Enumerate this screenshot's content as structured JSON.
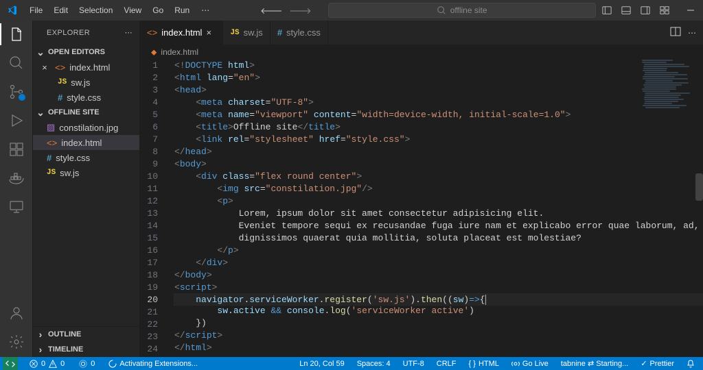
{
  "menu": [
    "File",
    "Edit",
    "Selection",
    "View",
    "Go",
    "Run"
  ],
  "search_placeholder": "offline site",
  "explorer": {
    "title": "EXPLORER",
    "open_editors_label": "OPEN EDITORS",
    "open_editors": [
      {
        "icon": "html",
        "name": "index.html",
        "closable": true
      },
      {
        "icon": "js",
        "name": "sw.js"
      },
      {
        "icon": "css",
        "name": "style.css"
      }
    ],
    "folder_label": "OFFLINE SITE",
    "files": [
      {
        "icon": "img",
        "name": "constilation.jpg"
      },
      {
        "icon": "html",
        "name": "index.html",
        "selected": true
      },
      {
        "icon": "css",
        "name": "style.css"
      },
      {
        "icon": "js",
        "name": "sw.js"
      }
    ],
    "outline": "OUTLINE",
    "timeline": "TIMELINE"
  },
  "tabs": [
    {
      "icon": "html",
      "name": "index.html",
      "active": true,
      "close": true
    },
    {
      "icon": "js",
      "name": "sw.js"
    },
    {
      "icon": "css",
      "name": "style.css"
    }
  ],
  "breadcrumb": {
    "icon": "html",
    "name": "index.html"
  },
  "code": {
    "current_line": 20,
    "lines": [
      [
        [
          "dt",
          "<!"
        ],
        [
          "tag",
          "DOCTYPE"
        ],
        [
          "text",
          " "
        ],
        [
          "attr",
          "html"
        ],
        [
          "dt",
          ">"
        ]
      ],
      [
        [
          "dt",
          "<"
        ],
        [
          "tag",
          "html"
        ],
        [
          "text",
          " "
        ],
        [
          "attr",
          "lang"
        ],
        [
          "punc",
          "="
        ],
        [
          "str",
          "\"en\""
        ],
        [
          "dt",
          ">"
        ]
      ],
      [
        [
          "dt",
          "<"
        ],
        [
          "tag",
          "head"
        ],
        [
          "dt",
          ">"
        ]
      ],
      [
        [
          "text",
          "    "
        ],
        [
          "dt",
          "<"
        ],
        [
          "tag",
          "meta"
        ],
        [
          "text",
          " "
        ],
        [
          "attr",
          "charset"
        ],
        [
          "punc",
          "="
        ],
        [
          "str",
          "\"UTF-8\""
        ],
        [
          "dt",
          ">"
        ]
      ],
      [
        [
          "text",
          "    "
        ],
        [
          "dt",
          "<"
        ],
        [
          "tag",
          "meta"
        ],
        [
          "text",
          " "
        ],
        [
          "attr",
          "name"
        ],
        [
          "punc",
          "="
        ],
        [
          "str",
          "\"viewport\""
        ],
        [
          "text",
          " "
        ],
        [
          "attr",
          "content"
        ],
        [
          "punc",
          "="
        ],
        [
          "str",
          "\"width=device-width, initial-scale=1.0\""
        ],
        [
          "dt",
          ">"
        ]
      ],
      [
        [
          "text",
          "    "
        ],
        [
          "dt",
          "<"
        ],
        [
          "tag",
          "title"
        ],
        [
          "dt",
          ">"
        ],
        [
          "text",
          "Offline site"
        ],
        [
          "dt",
          "</"
        ],
        [
          "tag",
          "title"
        ],
        [
          "dt",
          ">"
        ]
      ],
      [
        [
          "text",
          "    "
        ],
        [
          "dt",
          "<"
        ],
        [
          "tag",
          "link"
        ],
        [
          "text",
          " "
        ],
        [
          "attr",
          "rel"
        ],
        [
          "punc",
          "="
        ],
        [
          "str",
          "\"stylesheet\""
        ],
        [
          "text",
          " "
        ],
        [
          "attr",
          "href"
        ],
        [
          "punc",
          "="
        ],
        [
          "str",
          "\"style.css\""
        ],
        [
          "dt",
          ">"
        ]
      ],
      [
        [
          "dt",
          "</"
        ],
        [
          "tag",
          "head"
        ],
        [
          "dt",
          ">"
        ]
      ],
      [
        [
          "dt",
          "<"
        ],
        [
          "tag",
          "body"
        ],
        [
          "dt",
          ">"
        ]
      ],
      [
        [
          "text",
          "    "
        ],
        [
          "dt",
          "<"
        ],
        [
          "tag",
          "div"
        ],
        [
          "text",
          " "
        ],
        [
          "attr",
          "class"
        ],
        [
          "punc",
          "="
        ],
        [
          "str",
          "\"flex round center\""
        ],
        [
          "dt",
          ">"
        ]
      ],
      [
        [
          "text",
          "        "
        ],
        [
          "dt",
          "<"
        ],
        [
          "tag",
          "img"
        ],
        [
          "text",
          " "
        ],
        [
          "attr",
          "src"
        ],
        [
          "punc",
          "="
        ],
        [
          "str",
          "\"constilation.jpg\""
        ],
        [
          "dt",
          "/>"
        ]
      ],
      [
        [
          "text",
          "        "
        ],
        [
          "dt",
          "<"
        ],
        [
          "tag",
          "p"
        ],
        [
          "dt",
          ">"
        ]
      ],
      [
        [
          "text",
          "            Lorem, ipsum dolor sit amet consectetur adipisicing elit."
        ]
      ],
      [
        [
          "text",
          "            Eveniet tempore sequi ex recusandae fuga iure nam et explicabo error quae laborum, ad,"
        ]
      ],
      [
        [
          "text",
          "            dignissimos quaerat quia mollitia, soluta placeat est molestiae?"
        ]
      ],
      [
        [
          "text",
          "        "
        ],
        [
          "dt",
          "</"
        ],
        [
          "tag",
          "p"
        ],
        [
          "dt",
          ">"
        ]
      ],
      [
        [
          "text",
          "    "
        ],
        [
          "dt",
          "</"
        ],
        [
          "tag",
          "div"
        ],
        [
          "dt",
          ">"
        ]
      ],
      [
        [
          "dt",
          "</"
        ],
        [
          "tag",
          "body"
        ],
        [
          "dt",
          ">"
        ]
      ],
      [
        [
          "dt",
          "<"
        ],
        [
          "tag",
          "script"
        ],
        [
          "dt",
          ">"
        ]
      ],
      [
        [
          "text",
          "    "
        ],
        [
          "var",
          "navigator"
        ],
        [
          "punc",
          "."
        ],
        [
          "var",
          "serviceWorker"
        ],
        [
          "punc",
          "."
        ],
        [
          "fn",
          "register"
        ],
        [
          "punc",
          "("
        ],
        [
          "str",
          "'sw.js'"
        ],
        [
          "punc",
          ")."
        ],
        [
          "fn",
          "then"
        ],
        [
          "punc",
          "(("
        ],
        [
          "var",
          "sw"
        ],
        [
          "punc",
          ")"
        ],
        [
          "kw",
          "=>"
        ],
        [
          "punc",
          "{"
        ],
        [
          "caret",
          ""
        ]
      ],
      [
        [
          "text",
          "        "
        ],
        [
          "var",
          "sw"
        ],
        [
          "punc",
          "."
        ],
        [
          "var",
          "active"
        ],
        [
          "text",
          " "
        ],
        [
          "kw",
          "&&"
        ],
        [
          "text",
          " "
        ],
        [
          "var",
          "console"
        ],
        [
          "punc",
          "."
        ],
        [
          "fn",
          "log"
        ],
        [
          "punc",
          "("
        ],
        [
          "str",
          "'serviceWorker active'"
        ],
        [
          "punc",
          ")"
        ]
      ],
      [
        [
          "text",
          "    "
        ],
        [
          "punc",
          "})"
        ]
      ],
      [
        [
          "dt",
          "</"
        ],
        [
          "tag",
          "script"
        ],
        [
          "dt",
          ">"
        ]
      ],
      [
        [
          "dt",
          "</"
        ],
        [
          "tag",
          "html"
        ],
        [
          "dt",
          ">"
        ]
      ]
    ]
  },
  "status": {
    "errors": "0",
    "warnings": "0",
    "port": "0",
    "activating": "Activating Extensions...",
    "lncol": "Ln 20, Col 59",
    "spaces": "Spaces: 4",
    "encoding": "UTF-8",
    "eol": "CRLF",
    "lang": "HTML",
    "golive": "Go Live",
    "tabnine": "tabnine ⇄ Starting...",
    "prettier": "Prettier"
  }
}
